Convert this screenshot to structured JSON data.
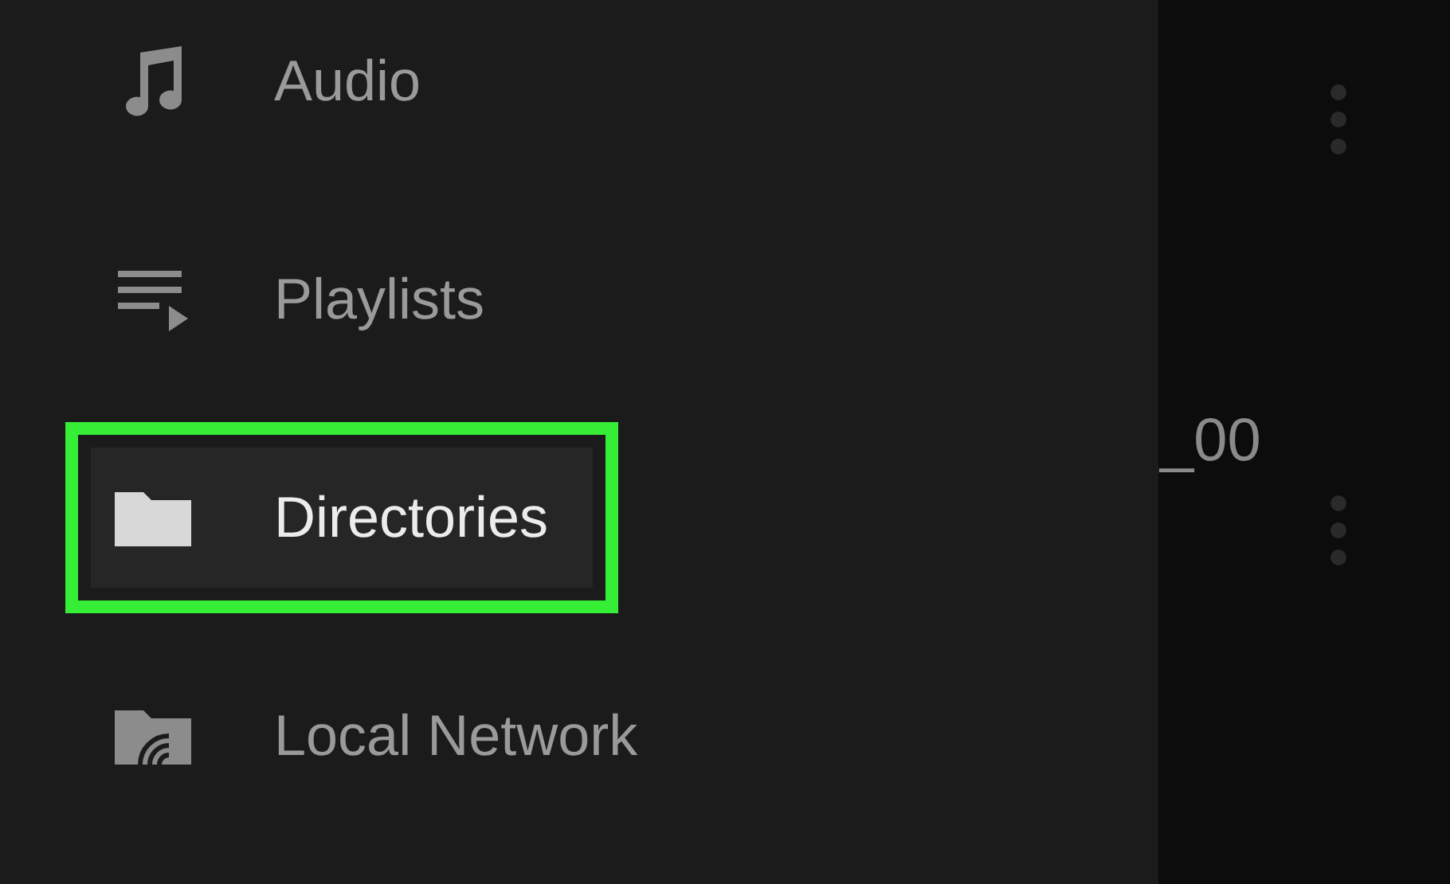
{
  "drawer": {
    "items": [
      {
        "kind": "audio",
        "label": "Audio",
        "selected": false,
        "highlighted": false
      },
      {
        "kind": "playlists",
        "label": "Playlists",
        "selected": false,
        "highlighted": false
      },
      {
        "kind": "directories",
        "label": "Directories",
        "selected": true,
        "highlighted": true
      },
      {
        "kind": "network",
        "label": "Local Network",
        "selected": false,
        "highlighted": false
      }
    ]
  },
  "content": {
    "text": "_00"
  }
}
